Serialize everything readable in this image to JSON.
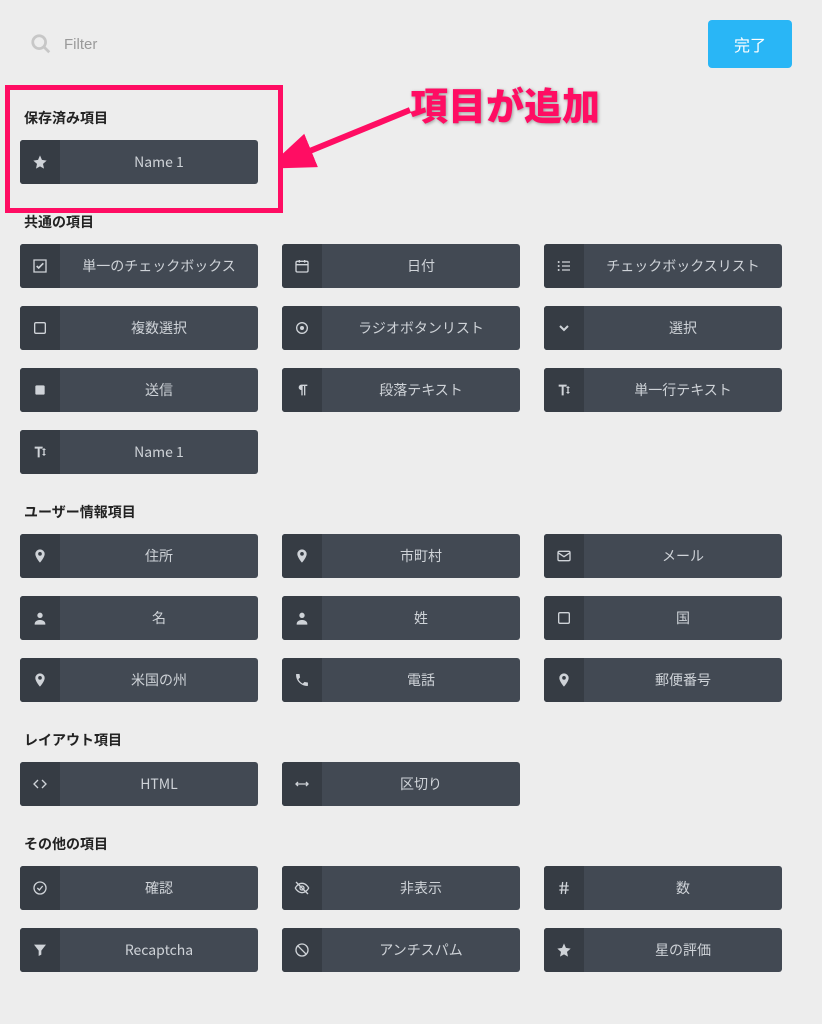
{
  "top": {
    "filter_placeholder": "Filter",
    "done_label": "完了"
  },
  "annotation": {
    "text": "項目が追加"
  },
  "sections": {
    "saved": {
      "title": "保存済み項目",
      "items": [
        {
          "icon": "star",
          "label": "Name 1"
        }
      ]
    },
    "common": {
      "title": "共通の項目",
      "items": [
        {
          "icon": "checkbox-checked",
          "label": "単一のチェックボックス"
        },
        {
          "icon": "calendar",
          "label": "日付"
        },
        {
          "icon": "list",
          "label": "チェックボックスリスト"
        },
        {
          "icon": "square",
          "label": "複数選択"
        },
        {
          "icon": "radio",
          "label": "ラジオボタンリスト"
        },
        {
          "icon": "chevron-down",
          "label": "選択"
        },
        {
          "icon": "square-filled",
          "label": "送信"
        },
        {
          "icon": "paragraph",
          "label": "段落テキスト"
        },
        {
          "icon": "text-height",
          "label": "単一行テキスト"
        },
        {
          "icon": "text-height",
          "label": "Name 1"
        }
      ]
    },
    "user": {
      "title": "ユーザー情報項目",
      "items": [
        {
          "icon": "map-marker",
          "label": "住所"
        },
        {
          "icon": "map-marker",
          "label": "市町村"
        },
        {
          "icon": "mail",
          "label": "メール"
        },
        {
          "icon": "user",
          "label": "名"
        },
        {
          "icon": "user",
          "label": "姓"
        },
        {
          "icon": "square",
          "label": "国"
        },
        {
          "icon": "map-marker",
          "label": "米国の州"
        },
        {
          "icon": "phone",
          "label": "電話"
        },
        {
          "icon": "map-marker",
          "label": "郵便番号"
        }
      ]
    },
    "layout": {
      "title": "レイアウト項目",
      "items": [
        {
          "icon": "code",
          "label": "HTML"
        },
        {
          "icon": "arrows-h",
          "label": "区切り"
        }
      ]
    },
    "other": {
      "title": "その他の項目",
      "items": [
        {
          "icon": "check-circle",
          "label": "確認"
        },
        {
          "icon": "eye-slash",
          "label": "非表示"
        },
        {
          "icon": "hash",
          "label": "数"
        },
        {
          "icon": "filter",
          "label": "Recaptcha"
        },
        {
          "icon": "ban",
          "label": "アンチスパム"
        },
        {
          "icon": "star",
          "label": "星の評価"
        }
      ]
    }
  }
}
